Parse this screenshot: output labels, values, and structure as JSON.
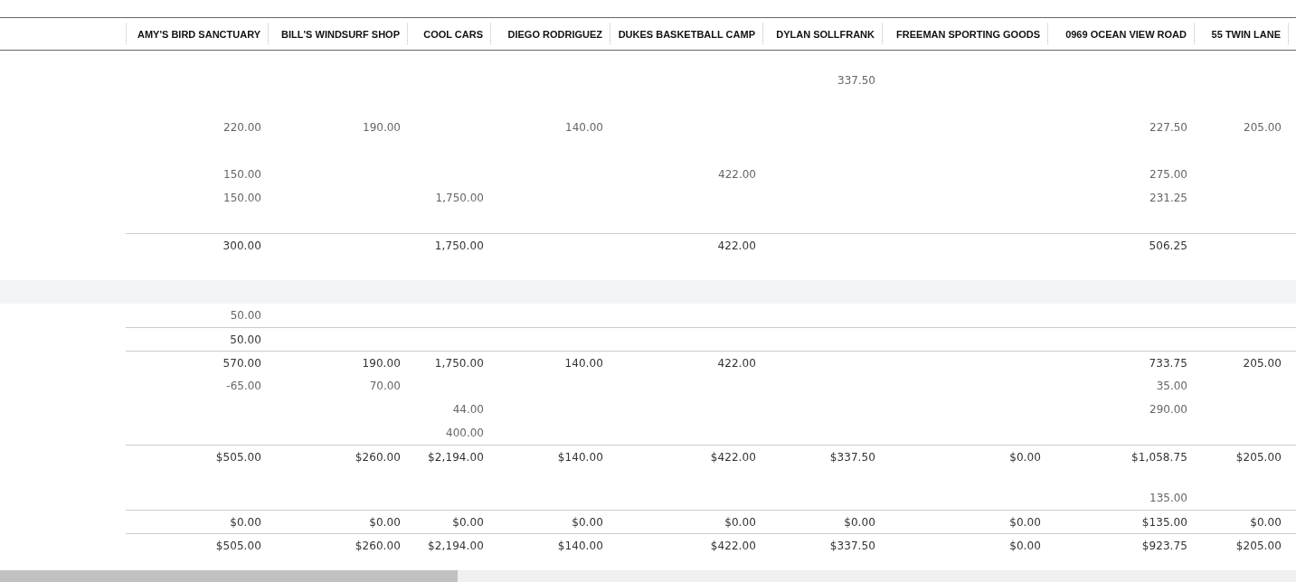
{
  "table": {
    "columns": [
      "AMY'S BIRD SANCTUARY",
      "BILL'S WINDSURF SHOP",
      "COOL CARS",
      "DIEGO RODRIGUEZ",
      "DUKES BASKETBALL CAMP",
      "DYLAN SOLLFRANK",
      "FREEMAN SPORTING GOODS",
      "0969 OCEAN VIEW ROAD",
      "55 TWIN LANE"
    ],
    "rows": [
      {
        "kind": "spacer"
      },
      {
        "kind": "detail",
        "cells": [
          null,
          null,
          null,
          null,
          null,
          "337.50",
          null,
          null,
          null
        ]
      },
      {
        "kind": "blank"
      },
      {
        "kind": "detail",
        "cells": [
          "220.00",
          "190.00",
          null,
          "140.00",
          null,
          null,
          null,
          "227.50",
          "205.00"
        ]
      },
      {
        "kind": "blank"
      },
      {
        "kind": "detail",
        "cells": [
          "150.00",
          null,
          null,
          null,
          "422.00",
          null,
          null,
          "275.00",
          null
        ]
      },
      {
        "kind": "detail",
        "cells": [
          "150.00",
          null,
          "1,750.00",
          null,
          null,
          null,
          null,
          "231.25",
          null
        ]
      },
      {
        "kind": "blank"
      },
      {
        "kind": "total",
        "cells": [
          "300.00",
          null,
          "1,750.00",
          null,
          "422.00",
          null,
          null,
          "506.25",
          null
        ]
      },
      {
        "kind": "blank"
      },
      {
        "kind": "section"
      },
      {
        "kind": "detail",
        "cells": [
          "50.00",
          null,
          null,
          null,
          null,
          null,
          null,
          null,
          null
        ]
      },
      {
        "kind": "total",
        "cells": [
          "50.00",
          null,
          null,
          null,
          null,
          null,
          null,
          null,
          null
        ]
      },
      {
        "kind": "total",
        "cells": [
          "570.00",
          "190.00",
          "1,750.00",
          "140.00",
          "422.00",
          null,
          null,
          "733.75",
          "205.00"
        ]
      },
      {
        "kind": "detail",
        "cells": [
          "-65.00",
          "70.00",
          null,
          null,
          null,
          null,
          null,
          "35.00",
          null
        ]
      },
      {
        "kind": "detail",
        "cells": [
          null,
          null,
          "44.00",
          null,
          null,
          null,
          null,
          "290.00",
          null
        ]
      },
      {
        "kind": "detail",
        "cells": [
          null,
          null,
          "400.00",
          null,
          null,
          null,
          null,
          null,
          null
        ]
      },
      {
        "kind": "total",
        "cells": [
          "$505.00",
          "$260.00",
          "$2,194.00",
          "$140.00",
          "$422.00",
          "$337.50",
          "$0.00",
          "$1,058.75",
          "$205.00"
        ]
      },
      {
        "kind": "spacer"
      },
      {
        "kind": "detail",
        "cells": [
          null,
          null,
          null,
          null,
          null,
          null,
          null,
          "135.00",
          null
        ]
      },
      {
        "kind": "total",
        "cells": [
          "$0.00",
          "$0.00",
          "$0.00",
          "$0.00",
          "$0.00",
          "$0.00",
          "$0.00",
          "$135.00",
          "$0.00"
        ]
      },
      {
        "kind": "total",
        "cells": [
          "$505.00",
          "$260.00",
          "$2,194.00",
          "$140.00",
          "$422.00",
          "$337.50",
          "$0.00",
          "$923.75",
          "$205.00"
        ]
      }
    ]
  }
}
